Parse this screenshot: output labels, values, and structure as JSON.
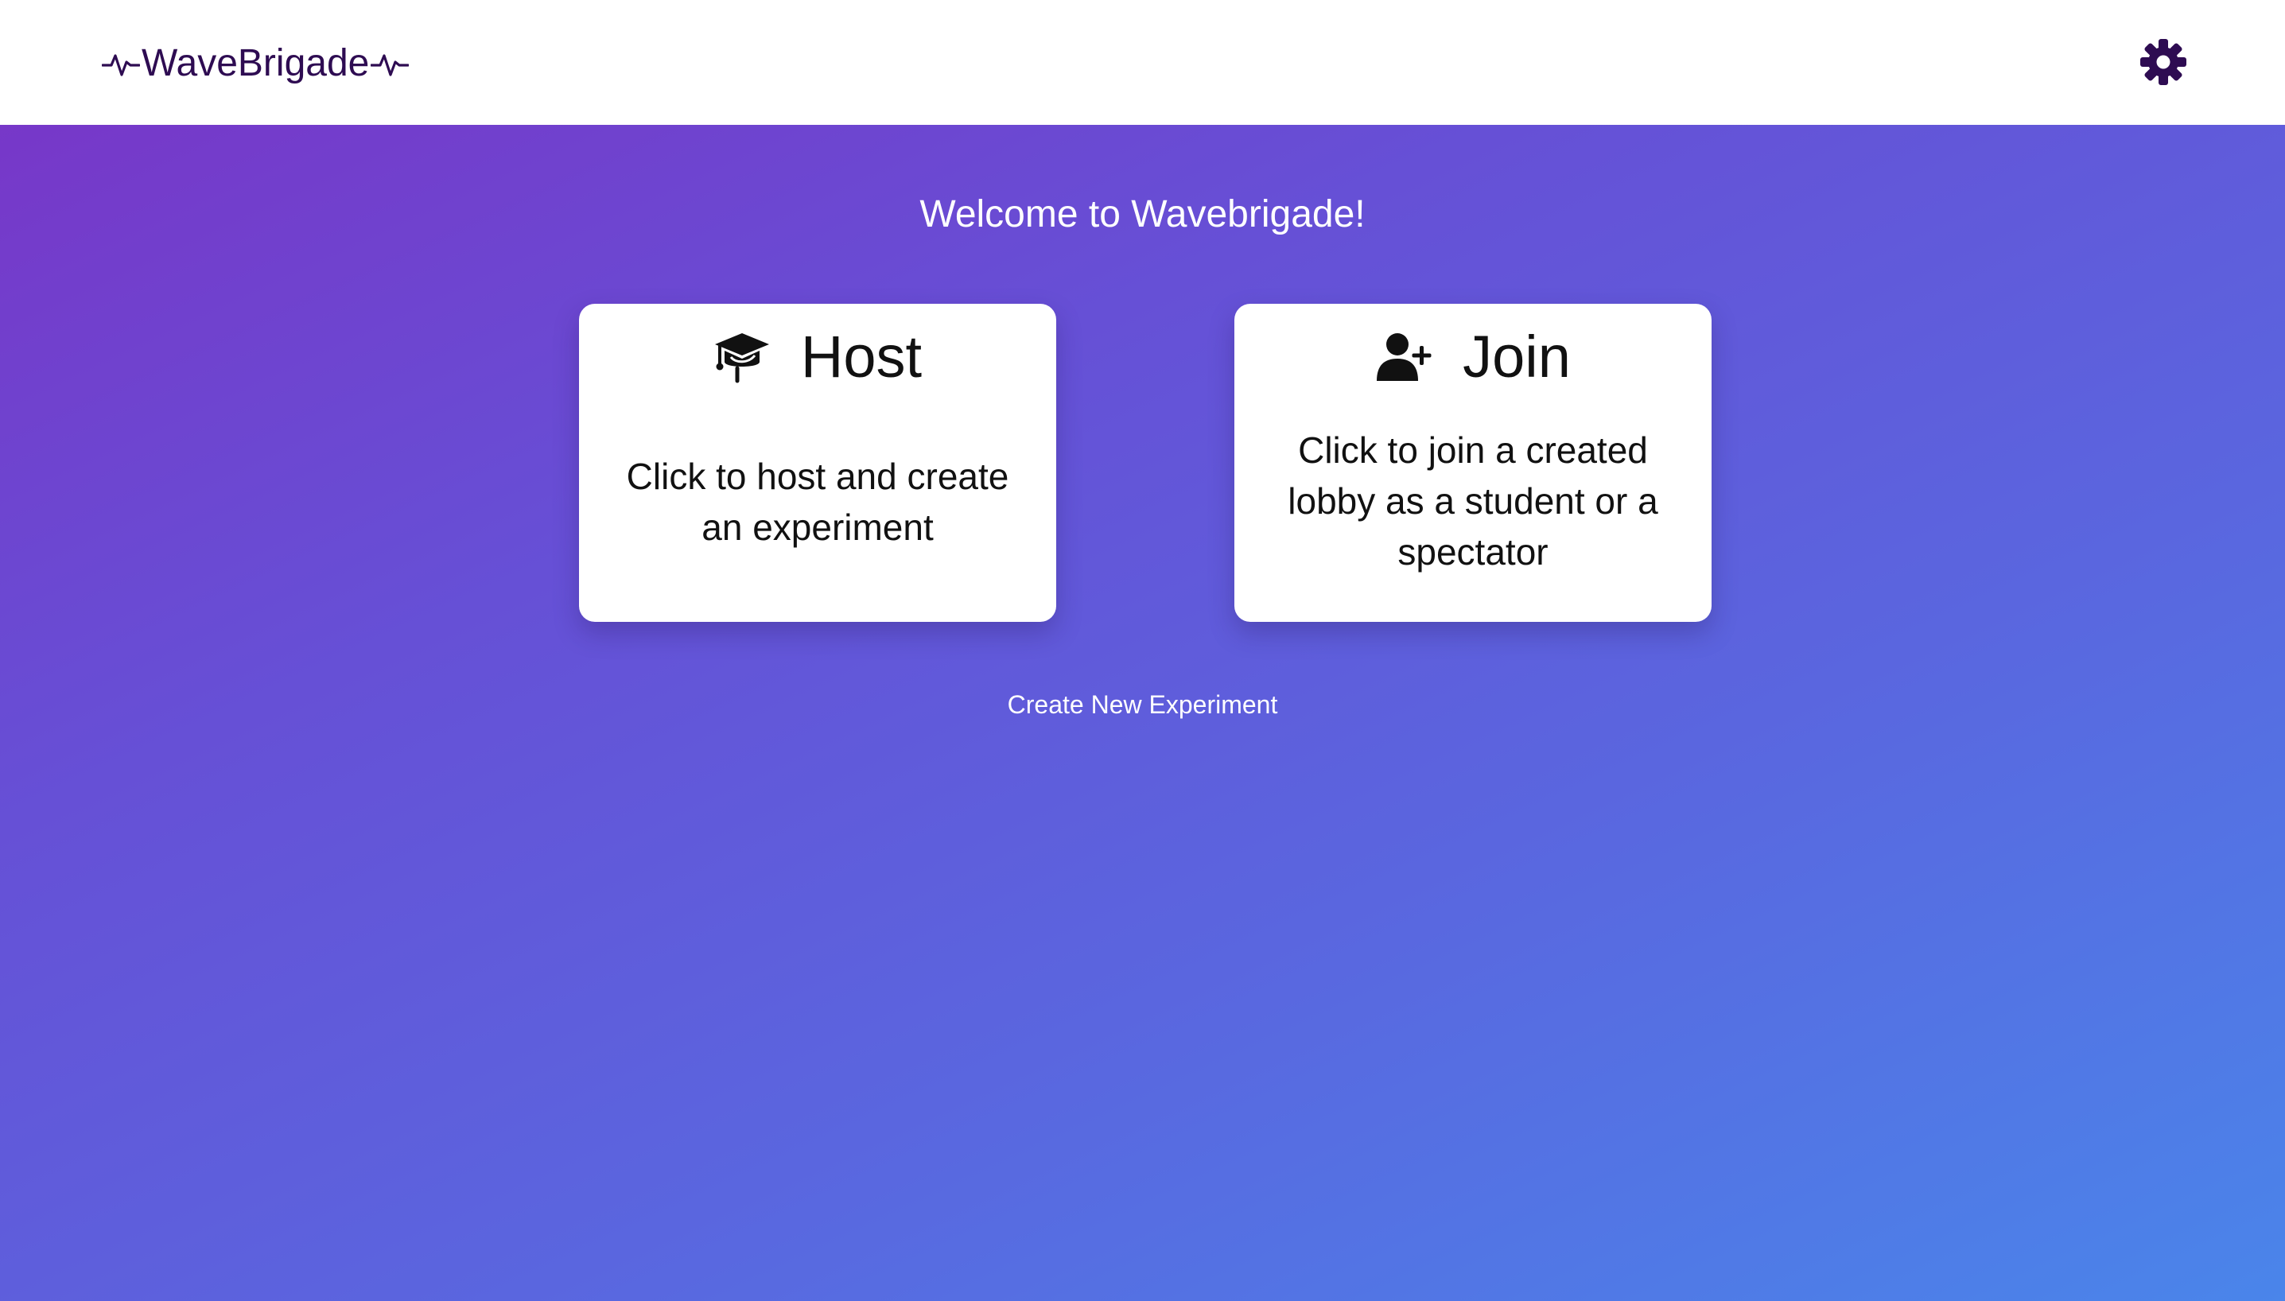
{
  "header": {
    "logo_text": "WaveBrigade",
    "settings_icon": "gear-icon"
  },
  "main": {
    "welcome_text": "Welcome to Wavebrigade!",
    "cards": {
      "host": {
        "icon": "graduation-cap-icon",
        "title": "Host",
        "description": "Click to host and create an experiment"
      },
      "join": {
        "icon": "user-plus-icon",
        "title": "Join",
        "description": "Click to join a created lobby as a student or a spectator"
      }
    },
    "create_link_label": "Create New Experiment"
  },
  "colors": {
    "brand_dark": "#2e0c52",
    "gradient_start": "#7a33c6",
    "gradient_end": "#4a85ea",
    "card_background": "#ffffff"
  }
}
